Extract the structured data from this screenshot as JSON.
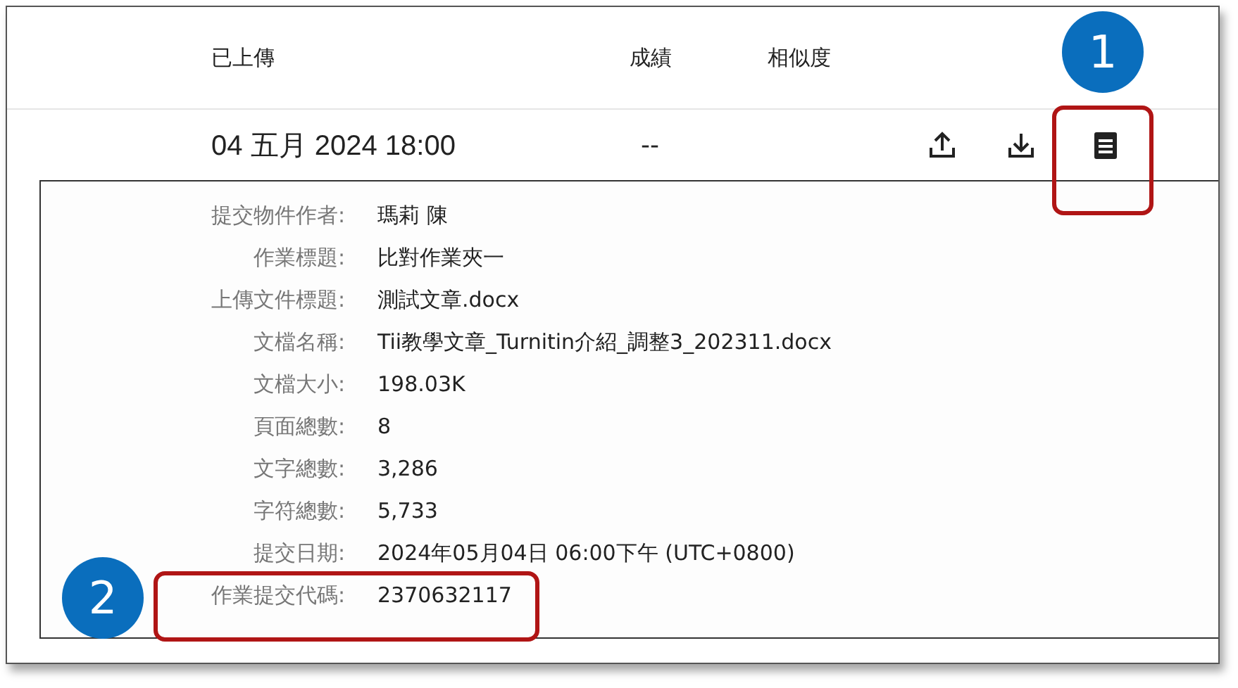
{
  "table": {
    "columns": [
      "已上傳",
      "成績",
      "相似度"
    ],
    "row": {
      "uploaded": "04 五月 2024 18:00",
      "grade": "--"
    }
  },
  "details": [
    {
      "label": "提交物件作者:",
      "value": "瑪莉 陳"
    },
    {
      "label": "作業標題:",
      "value": "比對作業夾一"
    },
    {
      "label": "上傳文件標題:",
      "value": "測試文章.docx"
    },
    {
      "label": "文檔名稱:",
      "value": "Tii教學文章_Turnitin介紹_調整3_202311.docx"
    },
    {
      "label": "文檔大小:",
      "value": "198.03K"
    },
    {
      "label": "頁面總數:",
      "value": "8"
    },
    {
      "label": "文字總數:",
      "value": "3,286"
    },
    {
      "label": "字符總數:",
      "value": "5,733"
    },
    {
      "label": "提交日期:",
      "value": "2024年05月04日 06:00下午 (UTC+0800)"
    },
    {
      "label": "作業提交代碼:",
      "value": "2370632117"
    }
  ],
  "callouts": [
    {
      "number": "1"
    },
    {
      "number": "2"
    }
  ]
}
